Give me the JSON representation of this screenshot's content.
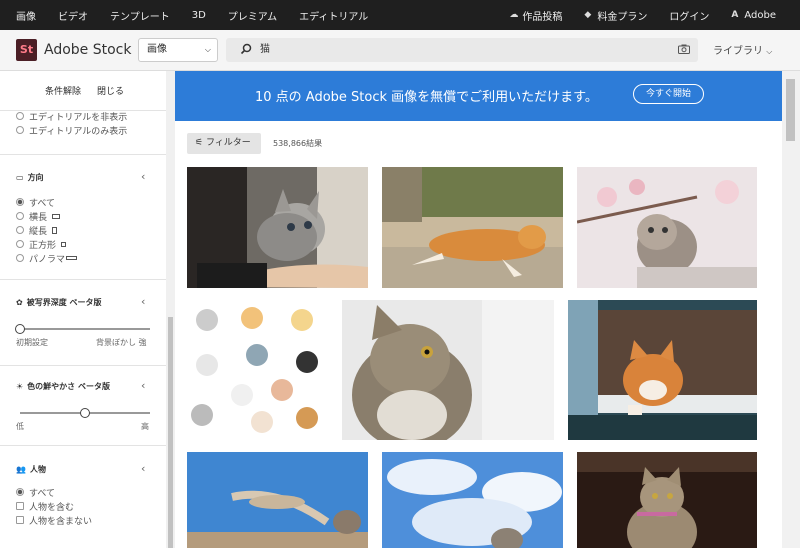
{
  "topnav": {
    "left": [
      "画像",
      "ビデオ",
      "テンプレート",
      "3D",
      "プレミアム",
      "エディトリアル"
    ],
    "upload": "作品投稿",
    "pricing": "料金プラン",
    "login": "ログイン",
    "adobe": "Adobe"
  },
  "header": {
    "logo": "St",
    "brand": "Adobe Stock",
    "type": "画像",
    "query": "猫",
    "library": "ライブラリ"
  },
  "sidebar": {
    "clear": "条件解除",
    "close": "閉じる",
    "editorial": [
      "エディトリアルを非表示",
      "エディトリアルのみ表示"
    ],
    "orientation": {
      "title": "方向",
      "options": [
        "すべて",
        "横長",
        "縦長",
        "正方形",
        "パノラマ"
      ]
    },
    "dof": {
      "title": "被写界深度 ベータ版",
      "min": "初期設定",
      "max": "背景ぼかし 強",
      "level": 0
    },
    "vivid": {
      "title": "色の鮮やかさ ベータ版",
      "min": "低",
      "max": "高",
      "level": 0.5
    },
    "people": {
      "title": "人物",
      "options": [
        "すべて",
        "人物を含む",
        "人物を含まない"
      ]
    }
  },
  "banner": {
    "text": "10 点の Adobe Stock 画像を無償でご利用いただけます。",
    "button": "今すぐ開始"
  },
  "results": {
    "filter": "フィルター",
    "count": "538,866結果"
  },
  "colors": {
    "banner": "#2d7cd8",
    "nav": "#1f1f1f",
    "logo_bg": "#4b1f26"
  }
}
